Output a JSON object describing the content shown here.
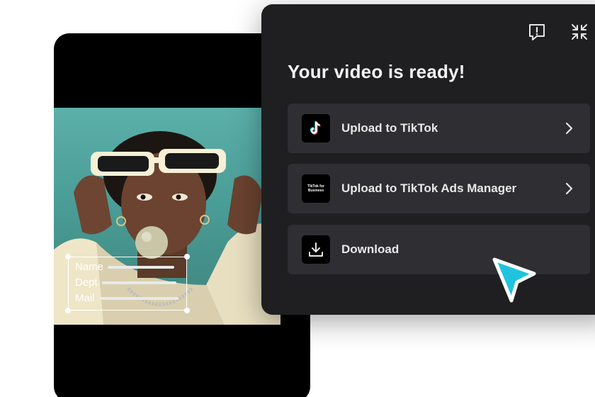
{
  "preview": {
    "overlay_fields": [
      {
        "label": "Name"
      },
      {
        "label": "Dept"
      },
      {
        "label": "Mail"
      }
    ]
  },
  "panel": {
    "title": "Your video is ready!",
    "top_icons": [
      "feedback-icon",
      "collapse-icon"
    ],
    "options": [
      {
        "label": "Upload to TikTok",
        "icon": "tiktok-logo-icon",
        "has_chevron": true
      },
      {
        "label": "Upload to TikTok Ads Manager",
        "icon": "tiktok-for-business-logo-icon",
        "icon_text": "TikTok for Business",
        "has_chevron": true
      },
      {
        "label": "Download",
        "icon": "download-icon",
        "has_chevron": false
      }
    ]
  },
  "colors": {
    "panel_bg": "#1f1f22",
    "option_bg": "#2e2e33",
    "cursor": "#1fc3e0",
    "tiktok_cyan": "#25f4ee",
    "tiktok_red": "#fe2c55"
  }
}
